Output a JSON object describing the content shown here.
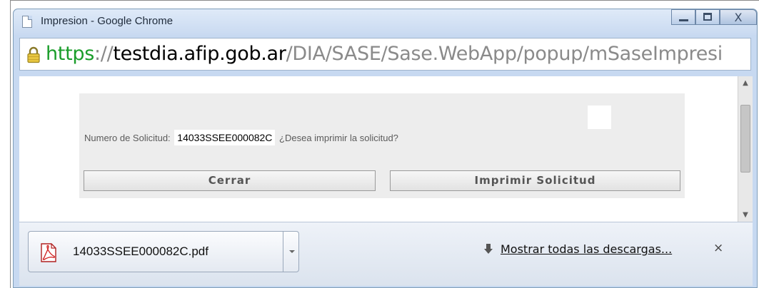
{
  "window": {
    "title": "Impresion - Google Chrome",
    "close_glyph": "X"
  },
  "address": {
    "scheme": "https",
    "separator": "://",
    "host": "testdia.afip.gob.ar",
    "path": "/DIA/SASE/Sase.WebApp/popup/mSaseImpresi"
  },
  "dialog": {
    "prompt_label": "Numero de Solicitud:",
    "request_number": "14033SSEE000082C",
    "question": "¿Desea imprimir la solicitud?",
    "close_button": "Cerrar",
    "print_button": "Imprimir Solicitud"
  },
  "downloads": {
    "filename": "14033SSEE000082C.pdf",
    "show_all": "Mostrar todas las descargas...",
    "close_glyph": "×"
  },
  "icons": {
    "page": "page-icon",
    "lock": "lock-icon",
    "pdf": "pdf-file-icon",
    "download": "download-arrow-icon",
    "minimize": "minimize-icon",
    "maximize": "maximize-icon",
    "close": "close-icon"
  },
  "colors": {
    "scheme_green": "#1a9d2a",
    "titlebar": "#c9daf1",
    "panel": "#ededed"
  }
}
